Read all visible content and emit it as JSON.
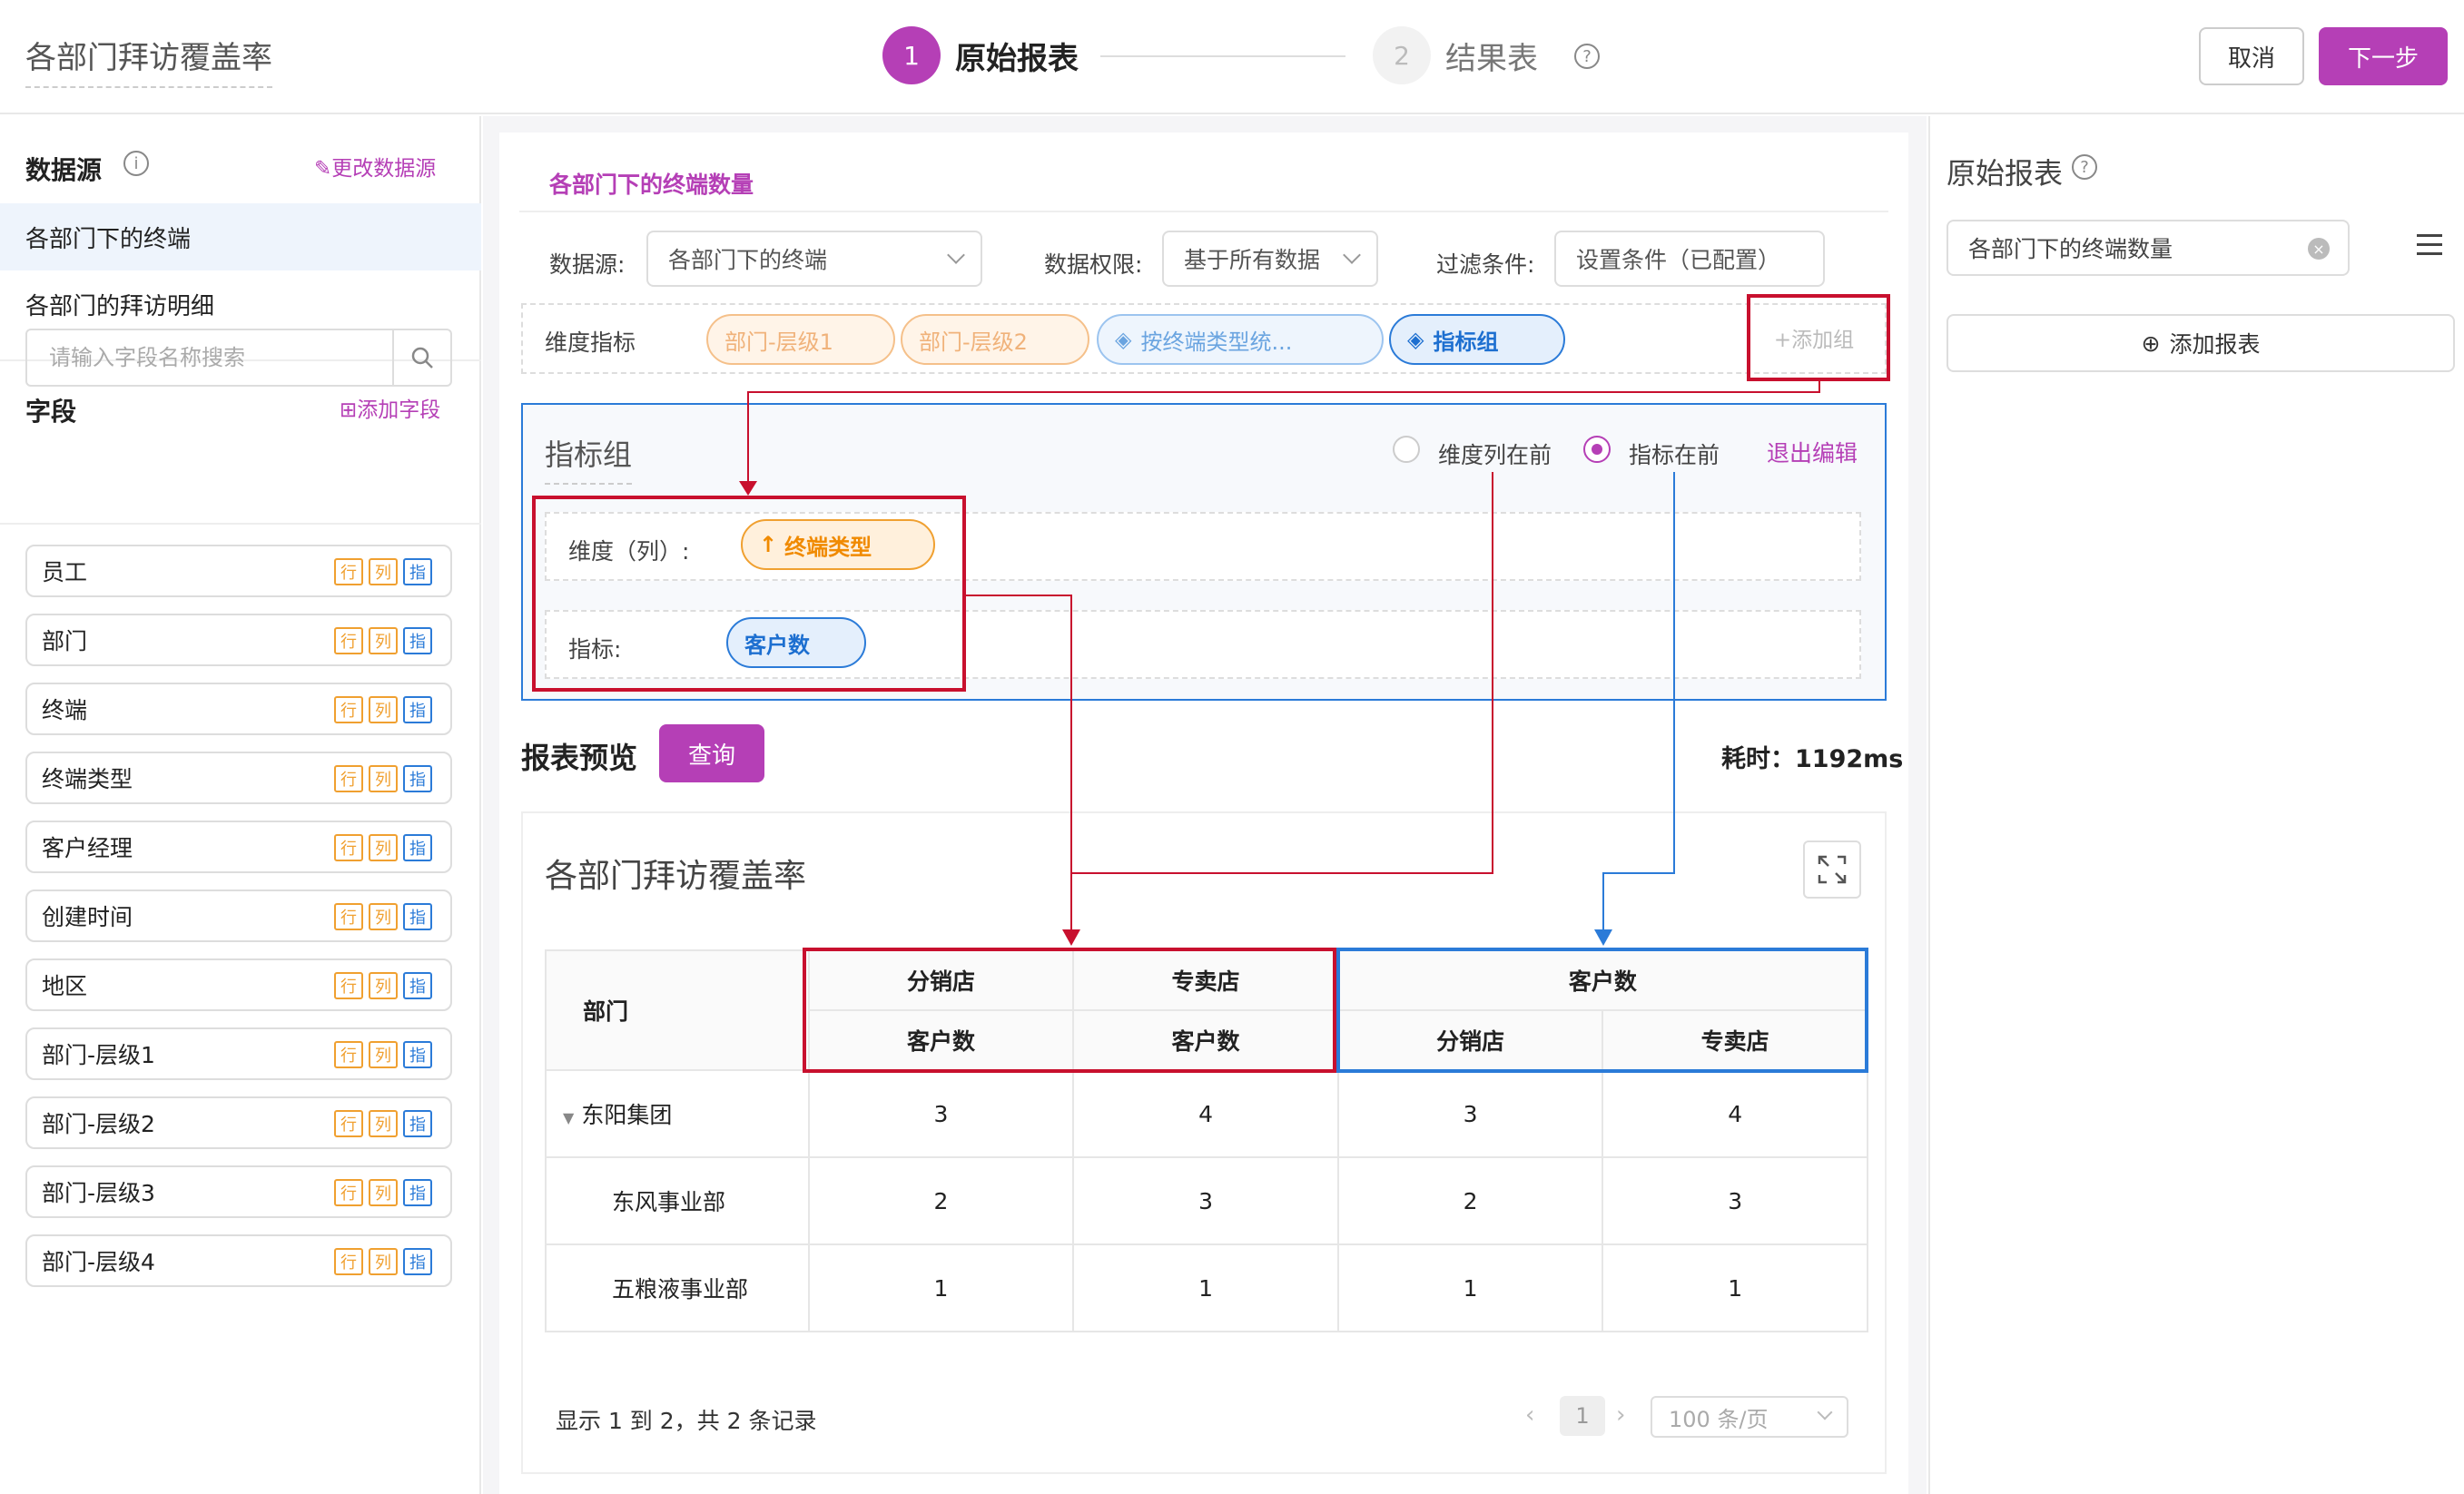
{
  "header": {
    "report_title": "各部门拜访覆盖率",
    "steps": [
      {
        "number": "1",
        "label": "原始报表"
      },
      {
        "number": "2",
        "label": "结果表"
      }
    ],
    "cancel_label": "取消",
    "next_label": "下一步"
  },
  "left": {
    "datasource_title": "数据源",
    "change_datasource": "更改数据源",
    "datasources": [
      "各部门下的终端",
      "各部门的拜访明细"
    ],
    "fields_title": "字段",
    "add_field": "添加字段",
    "search_placeholder": "请输入字段名称搜索",
    "tag_row": "行",
    "tag_col": "列",
    "tag_ind": "指",
    "fields": [
      "员工",
      "部门",
      "终端",
      "终端类型",
      "客户经理",
      "创建时间",
      "地区",
      "部门-层级1",
      "部门-层级2",
      "部门-层级3",
      "部门-层级4"
    ]
  },
  "center": {
    "section_title": "各部门下的终端数量",
    "datasource_label": "数据源:",
    "datasource_value": "各部门下的终端",
    "permission_label": "数据权限:",
    "permission_value": "基于所有数据",
    "filter_label": "过滤条件:",
    "filter_value": "设置条件（已配置）",
    "dim_label": "维度指标",
    "dim_pills": [
      "部门-层级1",
      "部门-层级2",
      "按终端类型统...",
      "指标组"
    ],
    "add_group": "+添加组",
    "indicator_group": {
      "title": "指标组",
      "opt_dim_first": "维度列在前",
      "opt_ind_first": "指标在前",
      "exit_edit": "退出编辑",
      "dim_col_label": "维度（列）:",
      "dim_col_pill": "终端类型",
      "ind_label": "指标:",
      "ind_pill": "客户数"
    },
    "preview_title": "报表预览",
    "query_label": "查询",
    "elapsed": "耗时：1192ms",
    "table": {
      "title": "各部门拜访覆盖率",
      "dept_header": "部门",
      "group1": [
        "分销店",
        "专卖店"
      ],
      "group1_metric": "客户数",
      "group2_header": "客户数",
      "group2": [
        "分销店",
        "专卖店"
      ],
      "rows": [
        {
          "name": "东阳集团",
          "values": [
            "3",
            "4",
            "3",
            "4"
          ]
        },
        {
          "name": "东风事业部",
          "values": [
            "2",
            "3",
            "2",
            "3"
          ]
        },
        {
          "name": "五粮液事业部",
          "values": [
            "1",
            "1",
            "1",
            "1"
          ]
        }
      ]
    },
    "pager": {
      "summary": "显示 1 到 2，共 2 条记录",
      "page": "1",
      "page_size": "100 条/页"
    }
  },
  "right": {
    "title": "原始报表",
    "report_input": "各部门下的终端数量",
    "add_report": "添加报表"
  },
  "colors": {
    "accent": "#b53fb6",
    "annotation_red": "#c8102e",
    "annotation_blue": "#2b7bd8"
  }
}
